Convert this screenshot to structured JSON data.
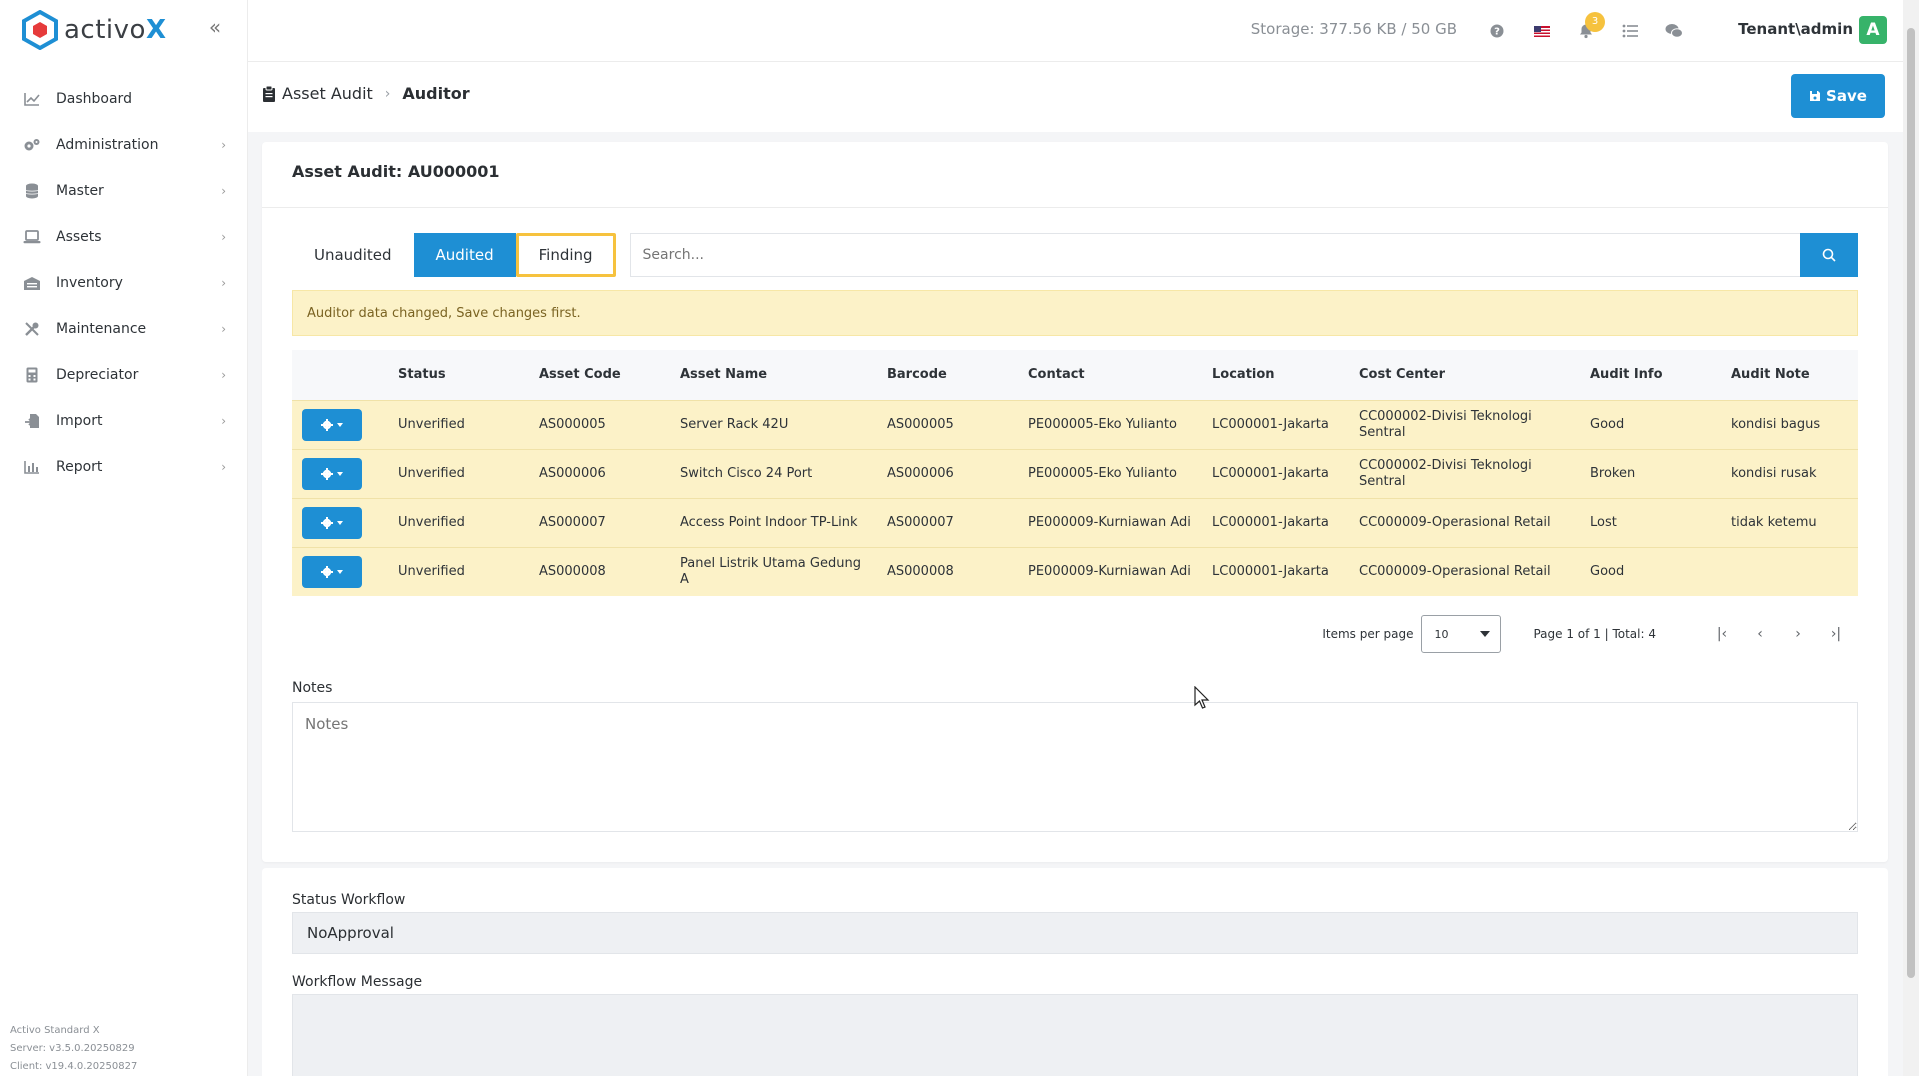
{
  "app": {
    "logo_text": "activo",
    "logo_x": "X",
    "collapse_icon": "double-chevron-left-icon"
  },
  "sidebar": {
    "items": [
      {
        "label": "Dashboard",
        "icon": "chart-line-icon",
        "has_children": false
      },
      {
        "label": "Administration",
        "icon": "cogs-icon",
        "has_children": true
      },
      {
        "label": "Master",
        "icon": "database-icon",
        "has_children": true
      },
      {
        "label": "Assets",
        "icon": "laptop-icon",
        "has_children": true
      },
      {
        "label": "Inventory",
        "icon": "warehouse-icon",
        "has_children": true
      },
      {
        "label": "Maintenance",
        "icon": "tools-icon",
        "has_children": true
      },
      {
        "label": "Depreciator",
        "icon": "calculator-icon",
        "has_children": true
      },
      {
        "label": "Import",
        "icon": "file-import-icon",
        "has_children": true
      },
      {
        "label": "Report",
        "icon": "chart-bar-icon",
        "has_children": true
      }
    ],
    "footer": {
      "product": "Activo Standard X",
      "server": "Server: v3.5.0.20250829",
      "client": "Client: v19.4.0.20250827"
    }
  },
  "topbar": {
    "storage": "Storage: 377.56 KB / 50 GB",
    "notifications_count": "3",
    "user": "Tenant\\admin",
    "avatar_letter": "A"
  },
  "breadcrumb": {
    "parent": "Asset Audit",
    "current": "Auditor"
  },
  "toolbar": {
    "save_label": "Save"
  },
  "card": {
    "title": "Asset Audit: AU000001",
    "tabs": [
      {
        "label": "Unaudited",
        "state": "default"
      },
      {
        "label": "Audited",
        "state": "active"
      },
      {
        "label": "Finding",
        "state": "focused"
      }
    ],
    "search_placeholder": "Search...",
    "alert": "Auditor data changed, Save changes first.",
    "columns": [
      "Status",
      "Asset Code",
      "Asset Name",
      "Barcode",
      "Contact",
      "Location",
      "Cost Center",
      "Audit Info",
      "Audit Note"
    ],
    "rows": [
      {
        "status": "Unverified",
        "code": "AS000005",
        "name": "Server Rack 42U",
        "barcode": "AS000005",
        "contact": "PE000005-Eko Yulianto",
        "location": "LC000001-Jakarta",
        "cost_center": "CC000002-Divisi Teknologi Sentral",
        "audit_info": "Good",
        "audit_note": "kondisi bagus"
      },
      {
        "status": "Unverified",
        "code": "AS000006",
        "name": "Switch Cisco 24 Port",
        "barcode": "AS000006",
        "contact": "PE000005-Eko Yulianto",
        "location": "LC000001-Jakarta",
        "cost_center": "CC000002-Divisi Teknologi Sentral",
        "audit_info": "Broken",
        "audit_note": "kondisi rusak"
      },
      {
        "status": "Unverified",
        "code": "AS000007",
        "name": "Access Point Indoor TP-Link",
        "barcode": "AS000007",
        "contact": "PE000009-Kurniawan Adi",
        "location": "LC000001-Jakarta",
        "cost_center": "CC000009-Operasional Retail",
        "audit_info": "Lost",
        "audit_note": "tidak ketemu"
      },
      {
        "status": "Unverified",
        "code": "AS000008",
        "name": "Panel Listrik Utama Gedung A",
        "barcode": "AS000008",
        "contact": "PE000009-Kurniawan Adi",
        "location": "LC000001-Jakarta",
        "cost_center": "CC000009-Operasional Retail",
        "audit_info": "Good",
        "audit_note": ""
      }
    ],
    "pager": {
      "items_per_page_label": "Items per page",
      "items_per_page": "10",
      "page_info": "Page 1 of 1 | Total: 4"
    },
    "notes_label": "Notes",
    "notes_placeholder": "Notes"
  },
  "workflow": {
    "status_label": "Status Workflow",
    "status_value": "NoApproval",
    "message_label": "Workflow Message"
  },
  "colors": {
    "primary": "#1e8fd4",
    "alert_bg": "#fcf2c8",
    "focus_ring": "#f6c23e",
    "avatar_bg": "#37b36a"
  }
}
